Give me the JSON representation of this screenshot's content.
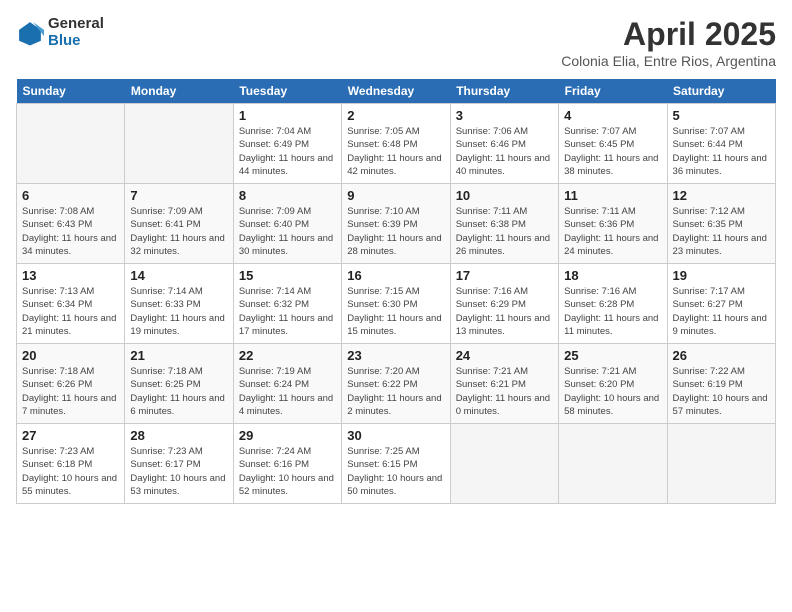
{
  "logo": {
    "text_general": "General",
    "text_blue": "Blue"
  },
  "title": "April 2025",
  "location": "Colonia Elia, Entre Rios, Argentina",
  "days_of_week": [
    "Sunday",
    "Monday",
    "Tuesday",
    "Wednesday",
    "Thursday",
    "Friday",
    "Saturday"
  ],
  "weeks": [
    [
      {
        "day": "",
        "sunrise": "",
        "sunset": "",
        "daylight": ""
      },
      {
        "day": "",
        "sunrise": "",
        "sunset": "",
        "daylight": ""
      },
      {
        "day": "1",
        "sunrise": "Sunrise: 7:04 AM",
        "sunset": "Sunset: 6:49 PM",
        "daylight": "Daylight: 11 hours and 44 minutes."
      },
      {
        "day": "2",
        "sunrise": "Sunrise: 7:05 AM",
        "sunset": "Sunset: 6:48 PM",
        "daylight": "Daylight: 11 hours and 42 minutes."
      },
      {
        "day": "3",
        "sunrise": "Sunrise: 7:06 AM",
        "sunset": "Sunset: 6:46 PM",
        "daylight": "Daylight: 11 hours and 40 minutes."
      },
      {
        "day": "4",
        "sunrise": "Sunrise: 7:07 AM",
        "sunset": "Sunset: 6:45 PM",
        "daylight": "Daylight: 11 hours and 38 minutes."
      },
      {
        "day": "5",
        "sunrise": "Sunrise: 7:07 AM",
        "sunset": "Sunset: 6:44 PM",
        "daylight": "Daylight: 11 hours and 36 minutes."
      }
    ],
    [
      {
        "day": "6",
        "sunrise": "Sunrise: 7:08 AM",
        "sunset": "Sunset: 6:43 PM",
        "daylight": "Daylight: 11 hours and 34 minutes."
      },
      {
        "day": "7",
        "sunrise": "Sunrise: 7:09 AM",
        "sunset": "Sunset: 6:41 PM",
        "daylight": "Daylight: 11 hours and 32 minutes."
      },
      {
        "day": "8",
        "sunrise": "Sunrise: 7:09 AM",
        "sunset": "Sunset: 6:40 PM",
        "daylight": "Daylight: 11 hours and 30 minutes."
      },
      {
        "day": "9",
        "sunrise": "Sunrise: 7:10 AM",
        "sunset": "Sunset: 6:39 PM",
        "daylight": "Daylight: 11 hours and 28 minutes."
      },
      {
        "day": "10",
        "sunrise": "Sunrise: 7:11 AM",
        "sunset": "Sunset: 6:38 PM",
        "daylight": "Daylight: 11 hours and 26 minutes."
      },
      {
        "day": "11",
        "sunrise": "Sunrise: 7:11 AM",
        "sunset": "Sunset: 6:36 PM",
        "daylight": "Daylight: 11 hours and 24 minutes."
      },
      {
        "day": "12",
        "sunrise": "Sunrise: 7:12 AM",
        "sunset": "Sunset: 6:35 PM",
        "daylight": "Daylight: 11 hours and 23 minutes."
      }
    ],
    [
      {
        "day": "13",
        "sunrise": "Sunrise: 7:13 AM",
        "sunset": "Sunset: 6:34 PM",
        "daylight": "Daylight: 11 hours and 21 minutes."
      },
      {
        "day": "14",
        "sunrise": "Sunrise: 7:14 AM",
        "sunset": "Sunset: 6:33 PM",
        "daylight": "Daylight: 11 hours and 19 minutes."
      },
      {
        "day": "15",
        "sunrise": "Sunrise: 7:14 AM",
        "sunset": "Sunset: 6:32 PM",
        "daylight": "Daylight: 11 hours and 17 minutes."
      },
      {
        "day": "16",
        "sunrise": "Sunrise: 7:15 AM",
        "sunset": "Sunset: 6:30 PM",
        "daylight": "Daylight: 11 hours and 15 minutes."
      },
      {
        "day": "17",
        "sunrise": "Sunrise: 7:16 AM",
        "sunset": "Sunset: 6:29 PM",
        "daylight": "Daylight: 11 hours and 13 minutes."
      },
      {
        "day": "18",
        "sunrise": "Sunrise: 7:16 AM",
        "sunset": "Sunset: 6:28 PM",
        "daylight": "Daylight: 11 hours and 11 minutes."
      },
      {
        "day": "19",
        "sunrise": "Sunrise: 7:17 AM",
        "sunset": "Sunset: 6:27 PM",
        "daylight": "Daylight: 11 hours and 9 minutes."
      }
    ],
    [
      {
        "day": "20",
        "sunrise": "Sunrise: 7:18 AM",
        "sunset": "Sunset: 6:26 PM",
        "daylight": "Daylight: 11 hours and 7 minutes."
      },
      {
        "day": "21",
        "sunrise": "Sunrise: 7:18 AM",
        "sunset": "Sunset: 6:25 PM",
        "daylight": "Daylight: 11 hours and 6 minutes."
      },
      {
        "day": "22",
        "sunrise": "Sunrise: 7:19 AM",
        "sunset": "Sunset: 6:24 PM",
        "daylight": "Daylight: 11 hours and 4 minutes."
      },
      {
        "day": "23",
        "sunrise": "Sunrise: 7:20 AM",
        "sunset": "Sunset: 6:22 PM",
        "daylight": "Daylight: 11 hours and 2 minutes."
      },
      {
        "day": "24",
        "sunrise": "Sunrise: 7:21 AM",
        "sunset": "Sunset: 6:21 PM",
        "daylight": "Daylight: 11 hours and 0 minutes."
      },
      {
        "day": "25",
        "sunrise": "Sunrise: 7:21 AM",
        "sunset": "Sunset: 6:20 PM",
        "daylight": "Daylight: 10 hours and 58 minutes."
      },
      {
        "day": "26",
        "sunrise": "Sunrise: 7:22 AM",
        "sunset": "Sunset: 6:19 PM",
        "daylight": "Daylight: 10 hours and 57 minutes."
      }
    ],
    [
      {
        "day": "27",
        "sunrise": "Sunrise: 7:23 AM",
        "sunset": "Sunset: 6:18 PM",
        "daylight": "Daylight: 10 hours and 55 minutes."
      },
      {
        "day": "28",
        "sunrise": "Sunrise: 7:23 AM",
        "sunset": "Sunset: 6:17 PM",
        "daylight": "Daylight: 10 hours and 53 minutes."
      },
      {
        "day": "29",
        "sunrise": "Sunrise: 7:24 AM",
        "sunset": "Sunset: 6:16 PM",
        "daylight": "Daylight: 10 hours and 52 minutes."
      },
      {
        "day": "30",
        "sunrise": "Sunrise: 7:25 AM",
        "sunset": "Sunset: 6:15 PM",
        "daylight": "Daylight: 10 hours and 50 minutes."
      },
      {
        "day": "",
        "sunrise": "",
        "sunset": "",
        "daylight": ""
      },
      {
        "day": "",
        "sunrise": "",
        "sunset": "",
        "daylight": ""
      },
      {
        "day": "",
        "sunrise": "",
        "sunset": "",
        "daylight": ""
      }
    ]
  ]
}
